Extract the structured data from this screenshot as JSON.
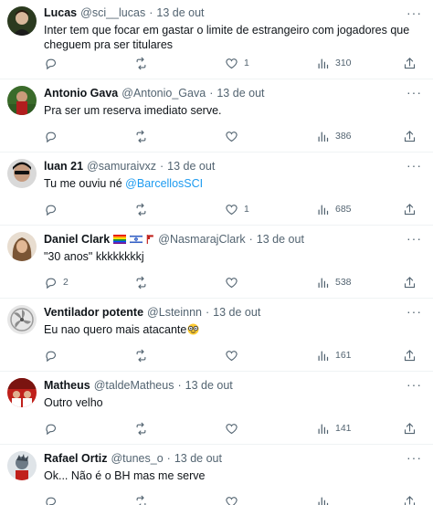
{
  "tweets": [
    {
      "name": "Lucas",
      "handle": "@sci__lucas",
      "date": "13 de out",
      "text": "Inter tem que focar em gastar o limite de estrangeiro com jogadores que cheguem pra ser titulares",
      "replies": "",
      "retweets": "",
      "likes": "1",
      "views": "310",
      "avatar_color": "#2b3a1f"
    },
    {
      "name": "Antonio Gava",
      "handle": "@Antonio_Gava",
      "date": "13 de out",
      "text": "Pra ser um reserva imediato serve.",
      "replies": "",
      "retweets": "",
      "likes": "",
      "views": "386",
      "avatar_color": "#3a6b2a"
    },
    {
      "name": "luan 21",
      "handle": "@samuraivxz",
      "date": "13 de out",
      "text_prefix": "Tu me ouviu né ",
      "mention": "@BarcellosSCI",
      "replies": "",
      "retweets": "",
      "likes": "1",
      "views": "685",
      "avatar_color": "#c9c9c9"
    },
    {
      "name": "Daniel Clark",
      "handle": "@NasmarajClark",
      "date": "13 de out",
      "text": "\"30 anos\" kkkkkkkkj",
      "replies": "2",
      "retweets": "",
      "likes": "",
      "views": "538",
      "avatar_color": "#a8845c"
    },
    {
      "name": "Ventilador potente",
      "handle": "@Lsteinnn",
      "date": "13 de out",
      "text": "Eu nao quero mais atacante",
      "replies": "",
      "retweets": "",
      "likes": "",
      "views": "161",
      "avatar_color": "#d8d8d8"
    },
    {
      "name": "Matheus",
      "handle": "@taldeMatheus",
      "date": "13 de out",
      "text": "Outro velho",
      "replies": "",
      "retweets": "",
      "likes": "",
      "views": "141",
      "avatar_color": "#c0201b"
    },
    {
      "name": "Rafael Ortiz",
      "handle": "@tunes_o",
      "date": "13 de out",
      "text": "Ok... Não é o BH mas me serve",
      "replies": "",
      "retweets": "",
      "likes": "",
      "views": "",
      "avatar_color": "#6c7a86"
    }
  ],
  "ui": {
    "dot": "·",
    "more": "···",
    "icons": {
      "reply": "reply-icon",
      "retweet": "retweet-icon",
      "like": "heart-icon",
      "views": "views-icon",
      "share": "share-icon"
    },
    "colors": {
      "text": "#0f1419",
      "secondary": "#536471",
      "link": "#1d9bf0",
      "divider": "#eff3f4"
    }
  }
}
